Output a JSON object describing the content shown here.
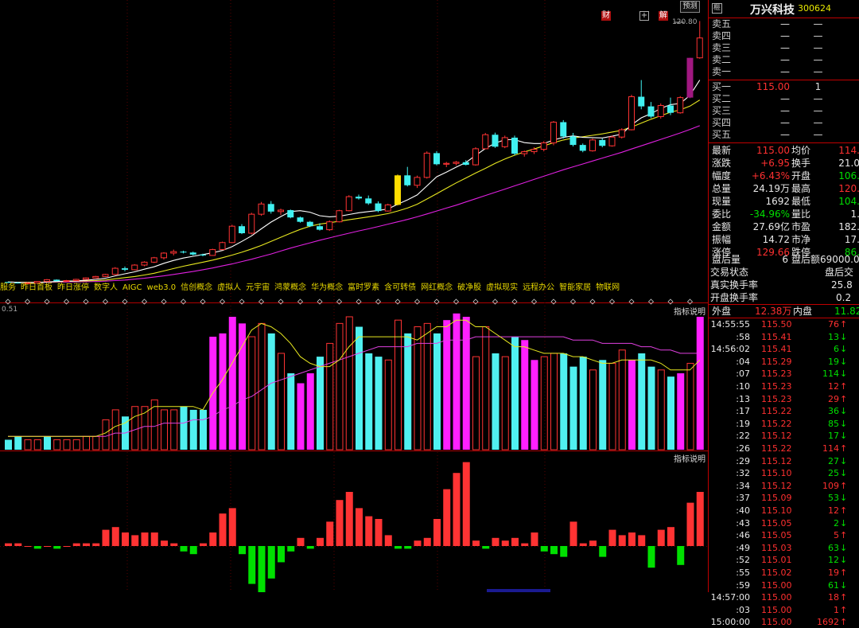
{
  "chart": {
    "predict_label": "预测",
    "badge_cai": "财",
    "badge_plus": "+",
    "badge_jie": "解",
    "price_high_label": "120.80",
    "vol_readout": "0.51",
    "indicator_label_1": "指标说明",
    "indicator_label_2": "指标说明",
    "concept_tags": [
      "服务",
      "昨日首板",
      "昨日涨停",
      "数字人",
      "AIGC",
      "web3.0",
      "信创概念",
      "虚拟人",
      "元宇宙",
      "鸿蒙概念",
      "华为概念",
      "富时罗素",
      "含可转债",
      "网红概念",
      "破净股",
      "虚拟现实",
      "远程办公",
      "智能家居",
      "物联网"
    ]
  },
  "chart_data": {
    "type": "candlestick",
    "candles": [
      [
        31.5,
        31.6,
        31.2,
        31.3
      ],
      [
        31.3,
        31.5,
        31.0,
        31.1
      ],
      [
        31.1,
        31.4,
        30.9,
        31.2
      ],
      [
        31.2,
        31.8,
        31.1,
        31.7
      ],
      [
        31.7,
        32.5,
        31.5,
        32.3
      ],
      [
        32.3,
        32.4,
        31.7,
        31.8
      ],
      [
        31.8,
        32.2,
        31.6,
        32.0
      ],
      [
        32.0,
        32.6,
        31.9,
        32.4
      ],
      [
        32.4,
        33.1,
        32.3,
        32.9
      ],
      [
        32.9,
        33.6,
        32.8,
        33.4
      ],
      [
        33.4,
        34.3,
        33.2,
        34.1
      ],
      [
        34.1,
        36.6,
        33.9,
        36.2
      ],
      [
        36.2,
        36.8,
        35.2,
        35.7
      ],
      [
        35.7,
        37.6,
        35.5,
        37.3
      ],
      [
        37.3,
        38.6,
        36.9,
        38.3
      ],
      [
        38.3,
        40.1,
        38.0,
        39.8
      ],
      [
        39.8,
        41.7,
        39.2,
        41.4
      ],
      [
        41.4,
        42.6,
        40.6,
        41.9
      ],
      [
        41.9,
        42.2,
        41.3,
        41.6
      ],
      [
        41.6,
        41.9,
        40.6,
        40.9
      ],
      [
        40.9,
        41.2,
        40.3,
        40.6
      ],
      [
        40.6,
        42.9,
        40.5,
        42.6
      ],
      [
        42.6,
        45.3,
        42.4,
        45.0
      ],
      [
        45.0,
        51.1,
        44.8,
        50.6
      ],
      [
        50.6,
        51.3,
        47.9,
        48.2
      ],
      [
        48.2,
        55.2,
        47.8,
        54.7
      ],
      [
        54.7,
        58.9,
        54.2,
        58.2
      ],
      [
        58.2,
        59.2,
        54.9,
        55.6
      ],
      [
        55.6,
        56.6,
        54.4,
        56.1
      ],
      [
        56.1,
        56.3,
        53.3,
        53.6
      ],
      [
        53.6,
        53.9,
        51.8,
        52.1
      ],
      [
        52.1,
        52.4,
        50.3,
        50.6
      ],
      [
        50.6,
        51.6,
        49.1,
        49.4
      ],
      [
        49.4,
        52.6,
        49.0,
        52.1
      ],
      [
        52.1,
        56.2,
        51.9,
        55.9
      ],
      [
        55.9,
        61.2,
        55.7,
        60.7
      ],
      [
        60.7,
        61.4,
        59.7,
        60.1
      ],
      [
        60.1,
        61.1,
        57.9,
        58.4
      ],
      [
        58.4,
        59.1,
        55.4,
        55.8
      ],
      [
        55.8,
        58.3,
        55.6,
        57.9
      ],
      [
        57.9,
        68.3,
        57.7,
        68.0
      ],
      [
        68.0,
        70.9,
        64.2,
        64.6
      ],
      [
        64.6,
        67.9,
        63.7,
        67.3
      ],
      [
        67.3,
        76.2,
        66.9,
        75.6
      ],
      [
        75.6,
        76.3,
        71.4,
        71.8
      ],
      [
        71.8,
        72.6,
        70.8,
        72.1
      ],
      [
        72.1,
        72.9,
        71.4,
        72.5
      ],
      [
        72.5,
        73.2,
        71.4,
        71.6
      ],
      [
        71.6,
        77.6,
        71.3,
        77.1
      ],
      [
        77.1,
        82.5,
        76.9,
        81.9
      ],
      [
        81.9,
        82.6,
        77.4,
        77.8
      ],
      [
        77.8,
        81.6,
        77.3,
        80.9
      ],
      [
        80.9,
        81.6,
        74.9,
        75.4
      ],
      [
        75.4,
        76.5,
        74.4,
        76.1
      ],
      [
        76.1,
        77.6,
        75.3,
        76.9
      ],
      [
        76.9,
        79.7,
        76.2,
        79.1
      ],
      [
        79.1,
        86.6,
        78.3,
        86.2
      ],
      [
        86.2,
        86.9,
        80.6,
        81.3
      ],
      [
        81.3,
        82.5,
        77.9,
        78.4
      ],
      [
        78.4,
        78.9,
        75.9,
        76.4
      ],
      [
        76.4,
        80.6,
        76.1,
        80.1
      ],
      [
        80.1,
        80.6,
        77.6,
        78.1
      ],
      [
        78.1,
        81.6,
        77.8,
        81.1
      ],
      [
        81.1,
        84.1,
        80.6,
        83.6
      ],
      [
        83.6,
        95.6,
        83.4,
        94.9
      ],
      [
        94.9,
        100.6,
        90.6,
        91.6
      ],
      [
        91.6,
        93.1,
        87.6,
        88.1
      ],
      [
        88.1,
        92.6,
        87.4,
        91.9
      ],
      [
        91.9,
        94.6,
        88.6,
        89.4
      ],
      [
        89.4,
        95.1,
        89.1,
        94.6
      ],
      [
        94.6,
        108.2,
        94.4,
        108.2
      ],
      [
        108.2,
        120.8,
        107.9,
        115.0
      ]
    ],
    "ma5": [
      31.5,
      31.4,
      31.3,
      31.3,
      31.5,
      31.7,
      31.8,
      31.9,
      32.1,
      32.4,
      32.8,
      33.6,
      34.3,
      35.0,
      35.9,
      36.7,
      37.9,
      38.9,
      39.7,
      40.3,
      40.9,
      41.5,
      42.3,
      43.6,
      45.4,
      47.3,
      49.7,
      52.0,
      53.9,
      55.6,
      55.9,
      55.4,
      54.2,
      53.8,
      54.0,
      54.6,
      55.2,
      55.6,
      56.0,
      56.5,
      58.1,
      59.6,
      61.3,
      64.4,
      67.5,
      69.1,
      70.8,
      72.4,
      74.8,
      77.2,
      79.0,
      80.2,
      80.2,
      79.2,
      78.9,
      78.9,
      80.1,
      81.0,
      81.5,
      81.0,
      80.9,
      80.8,
      81.4,
      82.1,
      85.3,
      87.7,
      89.1,
      90.9,
      92.2,
      92.6,
      95.4,
      100.6
    ],
    "ma10": [
      31.5,
      31.4,
      31.4,
      31.4,
      31.5,
      31.6,
      31.7,
      31.8,
      31.9,
      32.0,
      32.2,
      32.6,
      33.0,
      33.4,
      33.9,
      34.5,
      35.3,
      36.1,
      36.9,
      37.6,
      38.3,
      39.0,
      39.8,
      40.7,
      41.7,
      42.8,
      44.0,
      45.4,
      46.8,
      48.2,
      49.5,
      50.6,
      51.3,
      51.8,
      52.3,
      52.8,
      53.3,
      53.8,
      54.3,
      54.9,
      55.8,
      56.8,
      58.1,
      59.9,
      61.7,
      63.6,
      65.4,
      67.1,
      68.8,
      70.4,
      72.1,
      73.6,
      74.9,
      76.0,
      77.0,
      78.1,
      79.2,
      80.1,
      80.8,
      81.2,
      81.7,
      82.2,
      82.8,
      83.4,
      84.5,
      85.9,
      87.2,
      88.4,
      89.6,
      90.4,
      91.7,
      93.8
    ],
    "ma20": [
      31.5,
      31.4,
      31.4,
      31.4,
      31.4,
      31.5,
      31.5,
      31.6,
      31.6,
      31.7,
      31.8,
      32.0,
      32.2,
      32.5,
      32.8,
      33.2,
      33.6,
      34.1,
      34.6,
      35.1,
      35.7,
      36.3,
      37.0,
      37.7,
      38.5,
      39.3,
      40.2,
      41.1,
      42.1,
      43.1,
      44.0,
      44.9,
      45.8,
      46.6,
      47.4,
      48.2,
      49.0,
      49.7,
      50.5,
      51.3,
      52.1,
      52.9,
      53.8,
      54.8,
      55.8,
      56.8,
      57.8,
      58.9,
      60.0,
      61.1,
      62.2,
      63.3,
      64.4,
      65.5,
      66.6,
      67.7,
      68.8,
      69.9,
      70.9,
      71.9,
      72.9,
      73.9,
      74.9,
      75.9,
      77.0,
      78.1,
      79.2,
      80.3,
      81.4,
      82.5,
      83.7,
      85.0
    ],
    "volume": [
      3,
      4,
      3,
      3,
      4,
      3,
      3,
      3,
      4,
      4,
      9,
      12,
      10,
      13,
      13,
      15,
      12,
      12,
      13,
      12,
      12,
      34,
      35,
      40,
      38,
      34,
      38,
      35,
      29,
      23,
      20,
      23,
      28,
      32,
      38,
      40,
      37,
      29,
      28,
      27,
      39,
      35,
      37,
      38,
      35,
      39,
      41,
      40,
      28,
      37,
      29,
      28,
      34,
      33,
      27,
      28,
      29,
      29,
      25,
      28,
      24,
      27,
      26,
      30,
      27,
      29,
      25,
      24,
      22,
      23,
      26,
      40
    ],
    "vol_colors_up": [
      false,
      false,
      true,
      true,
      false,
      true,
      true,
      true,
      true,
      true,
      true,
      true,
      false,
      true,
      true,
      true,
      true,
      true,
      false,
      false,
      false,
      true,
      true,
      true,
      false,
      true,
      true,
      false,
      true,
      false,
      false,
      false,
      false,
      true,
      true,
      true,
      false,
      false,
      false,
      true,
      true,
      false,
      true,
      true,
      false,
      true,
      true,
      false,
      true,
      true,
      false,
      true,
      false,
      true,
      true,
      true,
      true,
      false,
      false,
      false,
      true,
      false,
      true,
      true,
      true,
      false,
      false,
      true,
      false,
      true,
      true,
      true
    ],
    "vol_ma5": [
      4,
      4,
      4,
      4,
      4,
      4,
      4,
      4,
      4,
      4,
      5,
      7,
      8,
      10,
      11,
      13,
      13,
      13,
      13,
      13,
      12,
      17,
      21,
      26,
      31,
      36,
      38,
      37,
      35,
      32,
      28,
      26,
      25,
      25,
      27,
      31,
      34,
      34,
      34,
      34,
      34,
      34,
      33,
      35,
      37,
      37,
      39,
      39,
      37,
      37,
      35,
      33,
      31,
      31,
      30,
      29,
      29,
      29,
      28,
      28,
      27,
      26,
      26,
      27,
      27,
      27,
      27,
      26,
      24,
      24,
      24,
      27
    ],
    "vol_ma20": [
      4,
      4,
      4,
      4,
      4,
      4,
      4,
      4,
      4,
      4,
      4,
      5,
      5,
      6,
      7,
      7,
      8,
      8,
      8,
      9,
      9,
      10,
      12,
      13,
      15,
      16,
      18,
      20,
      21,
      22,
      23,
      24,
      25,
      26,
      27,
      28,
      29,
      30,
      31,
      31,
      31,
      31,
      32,
      32,
      32,
      33,
      33,
      33,
      34,
      34,
      34,
      34,
      34,
      34,
      34,
      34,
      34,
      34,
      33,
      33,
      33,
      32,
      32,
      32,
      32,
      31,
      31,
      30,
      30,
      29,
      29,
      29
    ],
    "macd": [
      0.1,
      0.1,
      0.0,
      -0.1,
      0.0,
      -0.1,
      0.0,
      0.1,
      0.1,
      0.1,
      0.6,
      0.7,
      0.5,
      0.4,
      0.5,
      0.5,
      0.2,
      0.1,
      -0.2,
      -0.3,
      0.1,
      0.5,
      1.2,
      1.4,
      -0.3,
      -1.4,
      -2.2,
      -1.2,
      -0.6,
      -0.2,
      0.3,
      -0.1,
      0.3,
      0.9,
      1.7,
      2.0,
      1.4,
      1.1,
      1.0,
      0.4,
      -0.1,
      -0.1,
      0.2,
      0.3,
      1.0,
      2.1,
      2.7,
      3.1,
      0.2,
      -0.1,
      0.3,
      0.2,
      0.3,
      0.1,
      0.5,
      -0.2,
      -0.3,
      -0.4,
      0.9,
      0.1,
      0.2,
      -0.4,
      0.6,
      0.4,
      0.5,
      0.4,
      -0.8,
      0.6,
      0.7,
      -0.7,
      1.6,
      2.0
    ]
  },
  "quote": {
    "header_icon": "榧",
    "name": "万兴科技",
    "code": "300624",
    "sell_levels": [
      {
        "label": "卖五",
        "price": "—",
        "vol": "—"
      },
      {
        "label": "卖四",
        "price": "—",
        "vol": "—"
      },
      {
        "label": "卖三",
        "price": "—",
        "vol": "—"
      },
      {
        "label": "卖二",
        "price": "—",
        "vol": "—"
      },
      {
        "label": "卖一",
        "price": "—",
        "vol": "—"
      }
    ],
    "buy_levels": [
      {
        "label": "买一",
        "price": "115.00",
        "vol": "1"
      },
      {
        "label": "买二",
        "price": "—",
        "vol": "—"
      },
      {
        "label": "买三",
        "price": "—",
        "vol": "—"
      },
      {
        "label": "买四",
        "price": "—",
        "vol": "—"
      },
      {
        "label": "买五",
        "price": "—",
        "vol": "—"
      }
    ],
    "stats": [
      {
        "l1": "最新",
        "v1": "115.00",
        "c1": "red",
        "l2": "均价",
        "v2": "114.",
        "c2": "red"
      },
      {
        "l1": "涨跌",
        "v1": "+6.95",
        "c1": "red",
        "l2": "换手",
        "v2": "21.0",
        "c2": "white"
      },
      {
        "l1": "幅度",
        "v1": "+6.43%",
        "c1": "red",
        "l2": "开盘",
        "v2": "106.",
        "c2": "green"
      },
      {
        "l1": "总量",
        "v1": "24.19万",
        "c1": "white",
        "l2": "最高",
        "v2": "120.",
        "c2": "red"
      },
      {
        "l1": "现量",
        "v1": "1692",
        "c1": "white",
        "l2": "最低",
        "v2": "104.",
        "c2": "green"
      },
      {
        "l1": "委比",
        "v1": "-34.96%",
        "c1": "green",
        "l2": "量比",
        "v2": "1.",
        "c2": "white"
      },
      {
        "l1": "金额",
        "v1": "27.69亿",
        "c1": "white",
        "l2": "市盈",
        "v2": "182.",
        "c2": "white"
      },
      {
        "l1": "振幅",
        "v1": "14.72",
        "c1": "white",
        "l2": "市净",
        "v2": "17.",
        "c2": "white"
      },
      {
        "l1": "涨停",
        "v1": "129.66",
        "c1": "red",
        "l2": "跌停",
        "v2": "86.",
        "c2": "green"
      }
    ],
    "after_hours_vol_label": "盘后量",
    "after_hours_vol": "6",
    "after_hours_amt_label": "盘后额",
    "after_hours_amt": "69000.0",
    "trade_state_label": "交易状态",
    "trade_state": "盘后交",
    "real_turnover_label": "真实换手率",
    "real_turnover": "25.8",
    "open_turnover_label": "开盘换手率",
    "open_turnover": "0.2",
    "outer_label": "外盘",
    "outer_val": "12.38万",
    "inner_label": "内盘",
    "inner_val": "11.82",
    "ticks": [
      {
        "t": "14:55:55",
        "p": "115.50",
        "v": "76",
        "d": "up"
      },
      {
        "t": ":58",
        "p": "115.41",
        "v": "13",
        "d": "down"
      },
      {
        "t": "14:56:02",
        "p": "115.41",
        "v": "6",
        "d": "down"
      },
      {
        "t": ":04",
        "p": "115.29",
        "v": "19",
        "d": "down"
      },
      {
        "t": ":07",
        "p": "115.23",
        "v": "114",
        "d": "down"
      },
      {
        "t": ":10",
        "p": "115.23",
        "v": "12",
        "d": "up"
      },
      {
        "t": ":13",
        "p": "115.23",
        "v": "29",
        "d": "up"
      },
      {
        "t": ":17",
        "p": "115.22",
        "v": "36",
        "d": "down"
      },
      {
        "t": ":19",
        "p": "115.22",
        "v": "85",
        "d": "down"
      },
      {
        "t": ":22",
        "p": "115.12",
        "v": "17",
        "d": "down"
      },
      {
        "t": ":26",
        "p": "115.22",
        "v": "114",
        "d": "up"
      },
      {
        "t": ":29",
        "p": "115.12",
        "v": "27",
        "d": "down"
      },
      {
        "t": ":32",
        "p": "115.10",
        "v": "25",
        "d": "down"
      },
      {
        "t": ":34",
        "p": "115.12",
        "v": "109",
        "d": "up"
      },
      {
        "t": ":37",
        "p": "115.09",
        "v": "53",
        "d": "down"
      },
      {
        "t": ":40",
        "p": "115.10",
        "v": "12",
        "d": "up"
      },
      {
        "t": ":43",
        "p": "115.05",
        "v": "2",
        "d": "down"
      },
      {
        "t": ":46",
        "p": "115.05",
        "v": "5",
        "d": "up"
      },
      {
        "t": ":49",
        "p": "115.03",
        "v": "63",
        "d": "down"
      },
      {
        "t": ":52",
        "p": "115.01",
        "v": "12",
        "d": "down"
      },
      {
        "t": ":55",
        "p": "115.02",
        "v": "19",
        "d": "up"
      },
      {
        "t": ":59",
        "p": "115.00",
        "v": "61",
        "d": "down"
      },
      {
        "t": "14:57:00",
        "p": "115.00",
        "v": "18",
        "d": "up"
      },
      {
        "t": ":03",
        "p": "115.00",
        "v": "1",
        "d": "up"
      },
      {
        "t": "15:00:00",
        "p": "115.00",
        "v": "1692",
        "d": "up"
      }
    ]
  }
}
